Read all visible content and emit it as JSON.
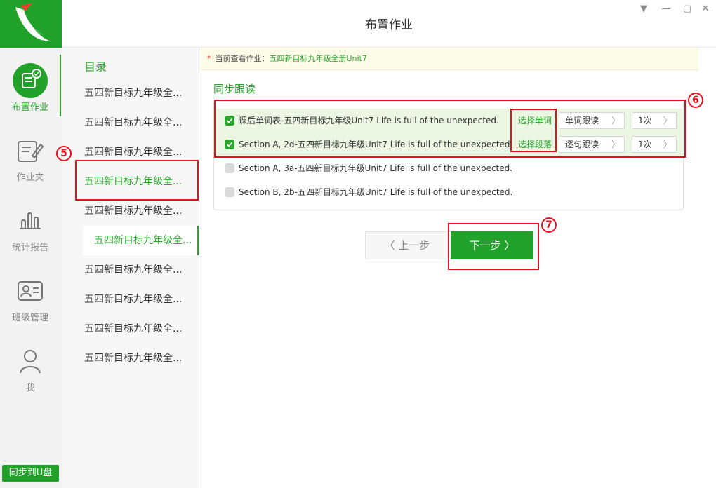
{
  "window": {
    "title": "布置作业"
  },
  "nav": {
    "items": [
      {
        "label": "布置作业",
        "icon": "assign-homework-icon",
        "active": true
      },
      {
        "label": "作业夹",
        "icon": "homework-folder-icon",
        "active": false
      },
      {
        "label": "统计报告",
        "icon": "bar-chart-icon",
        "active": false
      },
      {
        "label": "班级管理",
        "icon": "class-card-icon",
        "active": false
      },
      {
        "label": "我",
        "icon": "user-icon",
        "active": false
      }
    ],
    "sync_button": "同步到U盘"
  },
  "catalog": {
    "title": "目录",
    "items": [
      "五四新目标九年级全...",
      "五四新目标九年级全...",
      "五四新目标九年级全...",
      "五四新目标九年级全...",
      "五四新目标九年级全...",
      "五四新目标九年级全...",
      "五四新目标九年级全...",
      "五四新目标九年级全...",
      "五四新目标九年级全...",
      "五四新目标九年级全..."
    ],
    "selected_index": 5
  },
  "main": {
    "notice_prefix": "当前查看作业：",
    "notice_homework": "五四新目标九年级全册Unit7",
    "section_title": "同步跟读",
    "rows": [
      {
        "text": "课后单词表-五四新目标九年级Unit7 Life is full of the unexpected.",
        "checked": true,
        "link": "选择单词",
        "mode": "单词跟读",
        "count": "1次"
      },
      {
        "text": "Section A, 2d-五四新目标九年级Unit7 Life is full of the unexpected.",
        "checked": true,
        "link": "选择段落",
        "mode": "逐句跟读",
        "count": "1次"
      },
      {
        "text": "Section A, 3a-五四新目标九年级Unit7 Life is full of the unexpected.",
        "checked": false
      },
      {
        "text": "Section B, 2b-五四新目标九年级Unit7 Life is full of the unexpected.",
        "checked": false
      }
    ],
    "prev_button": "上一步",
    "next_button": "下一步"
  },
  "annotations": {
    "callouts": [
      "5",
      "6",
      "7"
    ]
  },
  "colors": {
    "brand_green": "#1fa12a",
    "annotation_red": "#e8101c",
    "highlight_bg": "#ebf7e2"
  }
}
